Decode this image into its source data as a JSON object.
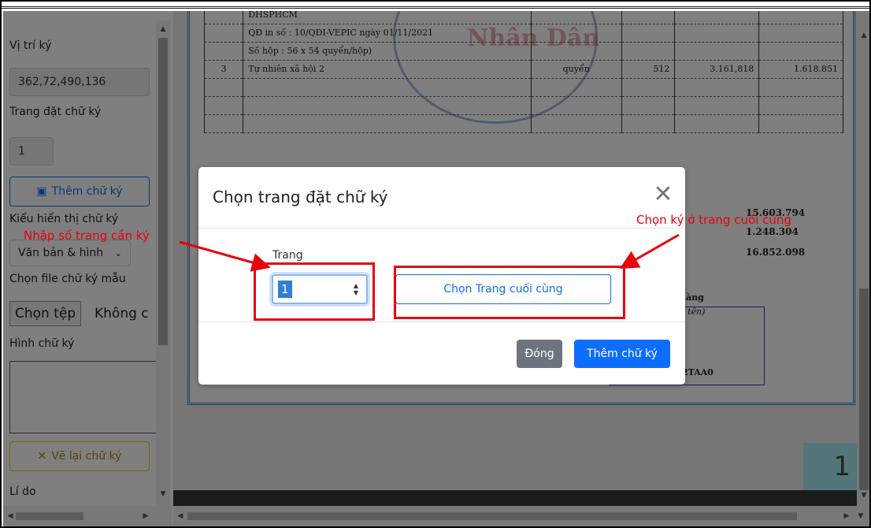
{
  "left_panel": {
    "signature_position_label": "Vị trí ký",
    "signature_position_value": "362,72,490,136",
    "signature_page_label": "Trang đặt chữ ký",
    "signature_page_value": "1",
    "add_signature_button": "Thêm chữ ký",
    "display_mode_label": "Kiểu hiển thị chữ ký",
    "display_mode_value": "Văn bản & hình",
    "sample_file_label": "Chọn file chữ ký mẫu",
    "choose_file_button": "Chọn tệp",
    "no_file_text": "Không c",
    "signature_image_label": "Hình chữ ký",
    "redraw_button": "Vẽ lại chữ ký",
    "reason_label": "Lí do"
  },
  "document": {
    "rows": [
      {
        "stt": "",
        "name": "ĐHSPHCM",
        "unit": "",
        "qty": "",
        "price": "",
        "amount": ""
      },
      {
        "stt": "",
        "name": "QĐ in số : 10/QĐI-VEPIC ngày 01/11/2021",
        "unit": "",
        "qty": "",
        "price": "",
        "amount": ""
      },
      {
        "stt": "",
        "name": "Số hộp : 56 x 54 quyển/hộp)",
        "unit": "",
        "qty": "",
        "price": "",
        "amount": ""
      },
      {
        "stt": "3",
        "name": "Tự nhiên xã hội 2",
        "unit": "quyển",
        "qty": "512",
        "price": "3.161,818",
        "amount": "1.618.851"
      }
    ],
    "stamp_text": "Nhân Dân",
    "total_1": "15.603.794",
    "total_2": "1.248.304",
    "total_3": "16.852.098",
    "sign_heading": "hàng",
    "sign_sub": "ọ tên)",
    "sign_code": "2TAA0",
    "page_badge": "1"
  },
  "modal": {
    "title": "Chọn trang đặt chữ ký",
    "page_label": "Trang",
    "page_value": "1",
    "last_page_button": "Chọn Trang cuối cùng",
    "close_button": "Đóng",
    "add_button": "Thêm chữ ký"
  },
  "annotations": {
    "left_note": "Nhập số trang cần ký",
    "right_note": "Chọn ký ở trang cuối cùng",
    "color": "#e8000b"
  },
  "colors": {
    "primary": "#0d6efd",
    "secondary": "#6c757d",
    "warning": "#ffc107"
  }
}
